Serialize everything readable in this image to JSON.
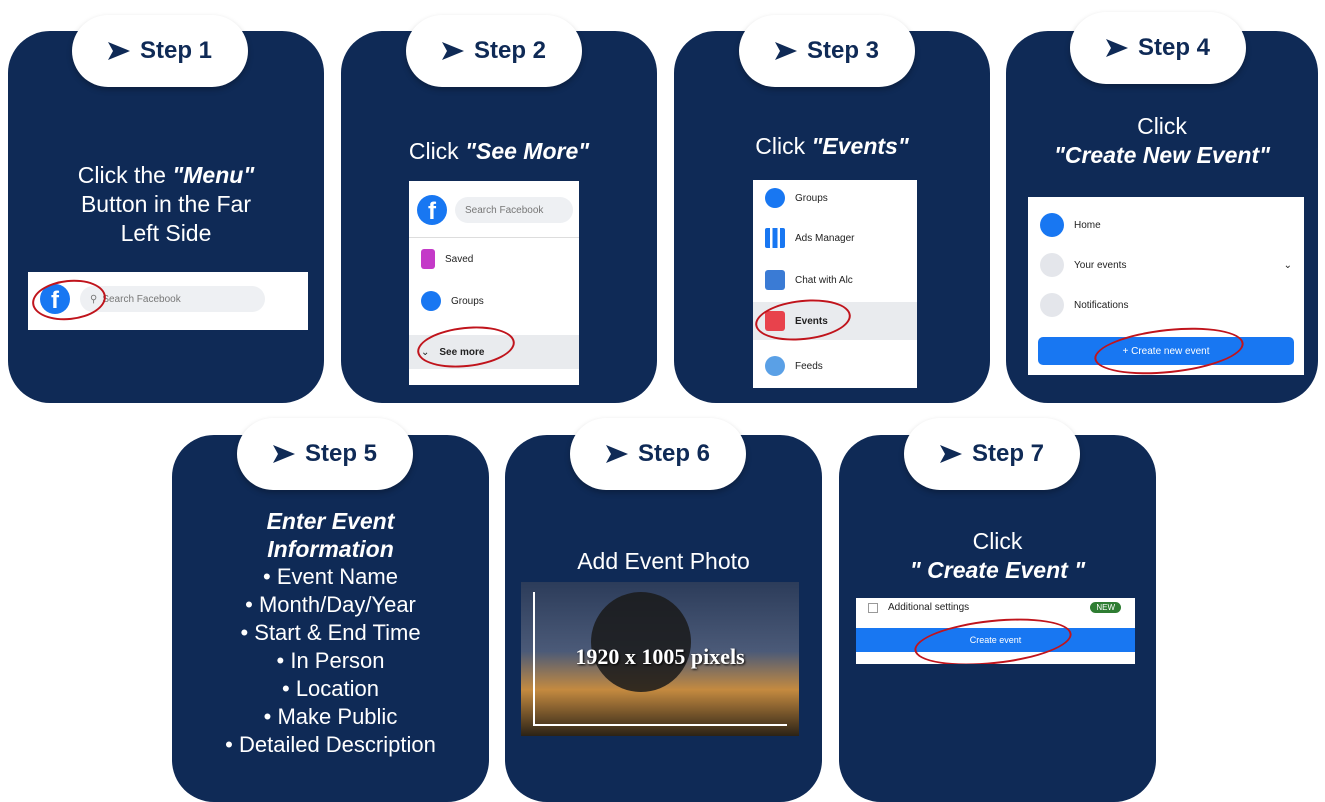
{
  "steps": [
    {
      "label": "Step 1",
      "lines": [
        "Click the",
        "\"Menu\"",
        "Button in the Far",
        "Left Side"
      ]
    },
    {
      "label": "Step 2",
      "lines": [
        "Click",
        "\"See More\""
      ]
    },
    {
      "label": "Step 3",
      "lines": [
        "Click",
        "\"Events\""
      ]
    },
    {
      "label": "Step 4",
      "lines": [
        "Click",
        "\"Create New Event\""
      ]
    },
    {
      "label": "Step 5",
      "title": "Enter Event Information",
      "bullets": [
        "Event Name",
        "Month/Day/Year",
        "Start & End Time",
        "In Person",
        "Location",
        "Make Public",
        "Detailed Description"
      ]
    },
    {
      "label": "Step 6",
      "lines": [
        "Add Event Photo"
      ]
    },
    {
      "label": "Step 7",
      "lines": [
        "Click",
        "\" Create Event \""
      ]
    }
  ],
  "screens": {
    "s1": {
      "search_placeholder": "Search Facebook"
    },
    "s2": {
      "search_placeholder": "Search Facebook",
      "items": [
        "Saved",
        "Groups",
        "See more"
      ]
    },
    "s3": {
      "items": [
        "Groups",
        "Ads Manager",
        "Chat with Alc",
        "Events",
        "Feeds"
      ]
    },
    "s4": {
      "items": [
        "Home",
        "Your events",
        "Notifications"
      ],
      "button": "+ Create new event"
    },
    "s6": {
      "photo_caption": "1920 x 1005 pixels"
    },
    "s7": {
      "settings_label": "Additional settings",
      "badge": "NEW",
      "button": "Create event"
    }
  },
  "colors": {
    "card": "#0f2a56",
    "accent": "#1877f2",
    "highlight": "#c0141c"
  }
}
